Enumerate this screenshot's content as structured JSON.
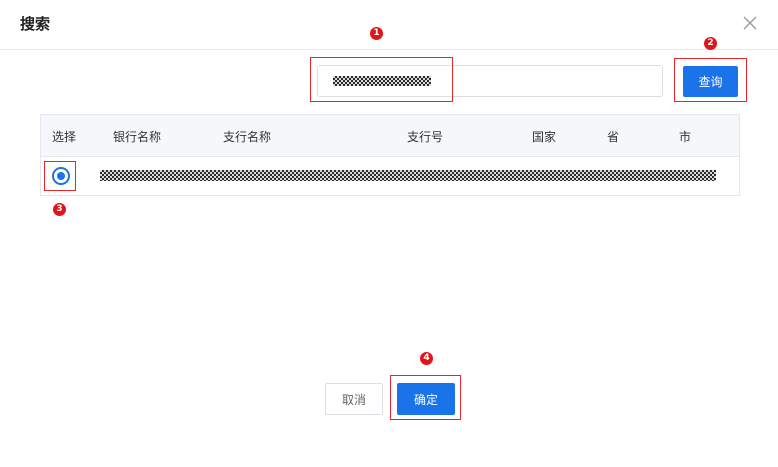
{
  "dialog": {
    "title": "搜索"
  },
  "search": {
    "value": "",
    "button_label": "查询"
  },
  "table": {
    "columns": [
      "选择",
      "银行名称",
      "支行名称",
      "支行号",
      "国家",
      "省",
      "市"
    ]
  },
  "footer": {
    "cancel_label": "取消",
    "confirm_label": "确定"
  },
  "markers": [
    "1",
    "2",
    "3",
    "4"
  ],
  "colors": {
    "primary": "#1a73e8",
    "marker": "#e2141a",
    "highlight_border": "#e6262b"
  },
  "icons": {
    "close": "close-icon",
    "radio": "radio-checked-icon"
  }
}
